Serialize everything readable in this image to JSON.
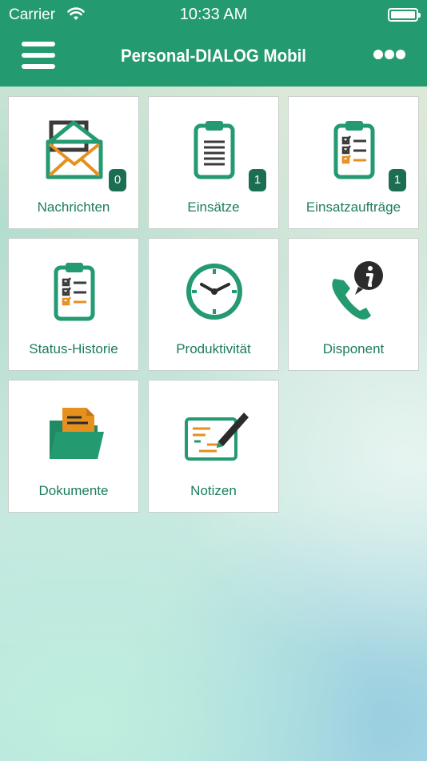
{
  "status_bar": {
    "carrier": "Carrier",
    "time": "10:33 AM",
    "wifi_icon": "wifi-icon",
    "battery_icon": "battery-icon"
  },
  "header": {
    "title": "Personal-DIALOG Mobil",
    "menu_icon": "hamburger-menu-icon",
    "more_icon": "more-dots-icon"
  },
  "colors": {
    "header_bg": "#249a70",
    "tile_label": "#1d7c5e",
    "badge_bg": "#1b6e52",
    "accent_orange": "#e6901f",
    "icon_dark": "#3b3b3b"
  },
  "tiles": [
    {
      "label": "Nachrichten",
      "icon": "envelope-icon",
      "badge": "0"
    },
    {
      "label": "Einsätze",
      "icon": "clipboard-list-icon",
      "badge": "1"
    },
    {
      "label": "Einsatzaufträge",
      "icon": "clipboard-checklist-icon",
      "badge": "1"
    },
    {
      "label": "Status-Historie",
      "icon": "status-history-icon"
    },
    {
      "label": "Produktivität",
      "icon": "clock-icon"
    },
    {
      "label": "Disponent",
      "icon": "phone-info-icon"
    },
    {
      "label": "Dokumente",
      "icon": "folder-document-icon"
    },
    {
      "label": "Notizen",
      "icon": "notes-pen-icon"
    }
  ]
}
